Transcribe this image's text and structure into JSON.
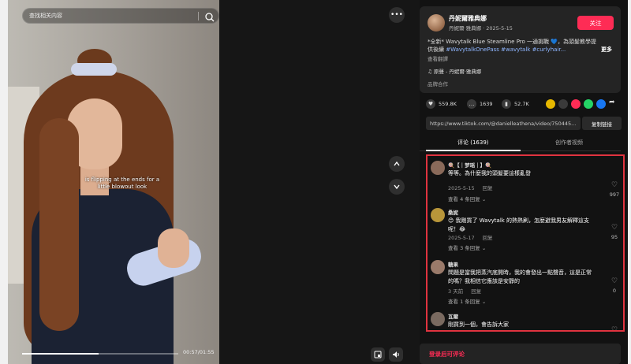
{
  "search": {
    "placeholder": "查找相关内容"
  },
  "video": {
    "caption_line1": "is flipping at the ends for a",
    "caption_line2": "little blowout look",
    "time": "00:57/01:55",
    "progress": 0.49
  },
  "author": {
    "name": "丹妮爾雅典娜",
    "sub": "丹妮爾·雅典娜 · 2025-5-15",
    "follow_label": "关注",
    "desc_text": "*全新* Wavytalk Blue Steamline Pro 一通挑戰 💙，為頭髮教學提供後續",
    "desc_tags": "#WavytalkOnePass #wavytalk #curlyhair...",
    "more_label": "更多",
    "translate_label": "查看翻譯",
    "music": "♫ 原聲 - 丹妮爾·雅典娜",
    "collab_label": "品牌合作"
  },
  "stats": {
    "likes": "559.8K",
    "comments": "1639",
    "saves": "52.7K"
  },
  "link": {
    "url": "https://www.tiktok.com/@danielleathena/video/750445...",
    "copy_label": "复制链接"
  },
  "tabs": [
    {
      "label": "评论 (1639)"
    },
    {
      "label": "创作者视频"
    }
  ],
  "comments": [
    {
      "user": "🍭【｜梦瑶｜】🍭",
      "text": "等等。為什麼我的頭髮要這樣亂發",
      "date": "2025-5-15",
      "reply": "回复",
      "more": "查看 4 条回复 ⌄",
      "likes": "997",
      "avatar_color": "#8a6a5a"
    },
    {
      "user": "桑妮",
      "text": "😊 我剛買了 Wavytalk 的熱熱刷，怎麼避我男友解釋這支呢！😂",
      "date": "2025-5-17",
      "reply": "回复",
      "more": "查看 3 条回复 ⌄",
      "likes": "95",
      "avatar_color": "#b8963a"
    },
    {
      "user": "糖果",
      "text": "問題是當我把蒸汽底開時，我的會發出一點聲音，這是正常的嗎？我相信它應該是安靜的",
      "date": "3 天前",
      "reply": "回复",
      "more": "查看 1 条回复 ⌄",
      "likes": "0",
      "avatar_color": "#9a7a6a"
    },
    {
      "user": "瓦爾",
      "text": "剛買到一個，會告訴大家",
      "date": "",
      "reply": "",
      "more": "",
      "likes": "",
      "avatar_color": "#7a6a60"
    }
  ],
  "login": {
    "label": "登录后可评论"
  },
  "colors": {
    "accent": "#fe2c55",
    "highlight_border": "#e0333f",
    "tag": "#8fb6ff"
  }
}
